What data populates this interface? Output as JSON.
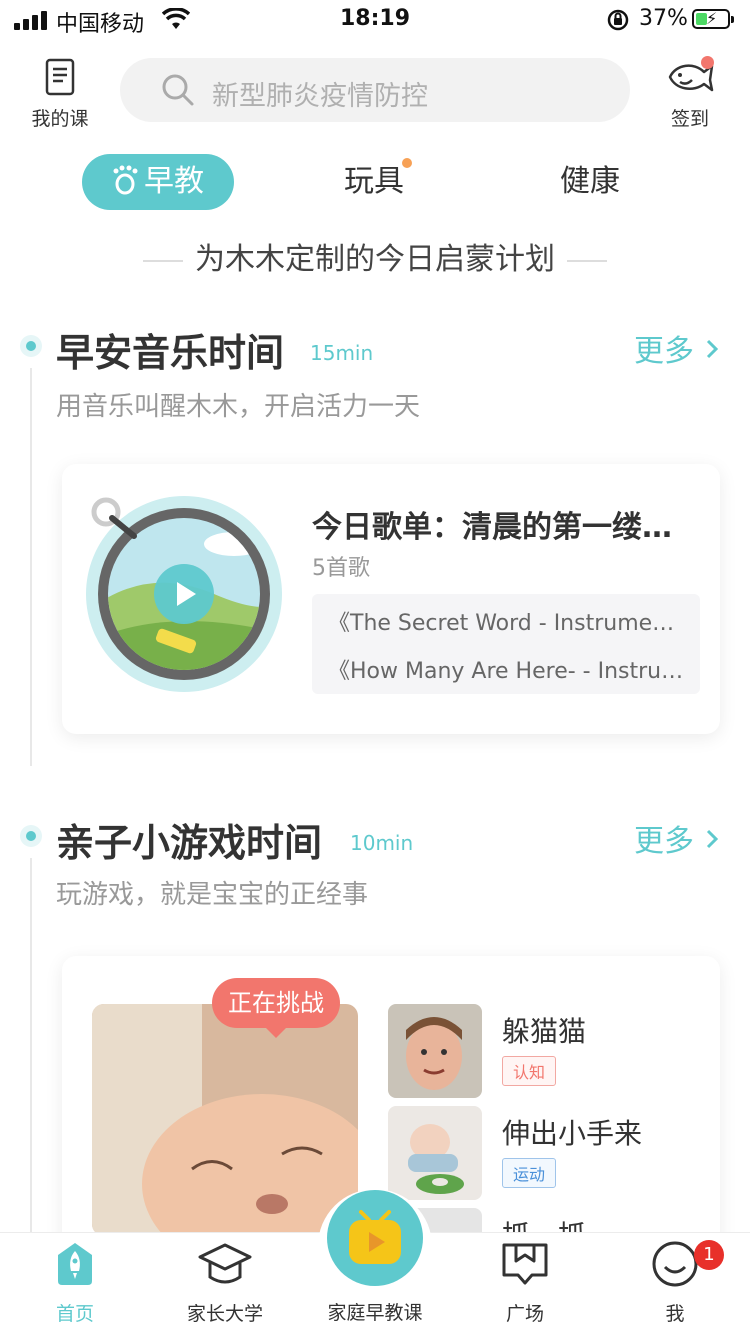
{
  "status_bar": {
    "carrier": "中国移动",
    "time": "18:19",
    "battery_percent": "37%",
    "battery_level": 0.37
  },
  "header": {
    "my_course_label": "我的课",
    "search_placeholder": "新型肺炎疫情防控",
    "signin_label": "签到"
  },
  "tabs": [
    {
      "label": "早教",
      "active": true
    },
    {
      "label": "玩具",
      "has_dot": true
    },
    {
      "label": "健康"
    }
  ],
  "plan_title": "为木木定制的今日启蒙计划",
  "sections": {
    "music": {
      "title": "早安音乐时间",
      "duration": "15min",
      "more": "更多",
      "subtitle": "用音乐叫醒木木，开启活力一天",
      "card": {
        "title": "今日歌单：清晨的第一缕阳光",
        "count": "5首歌",
        "songs": [
          "《The Secret Word - Instrumental》",
          "《How Many Are Here- - Instrumental》"
        ]
      }
    },
    "games": {
      "title": "亲子小游戏时间",
      "duration": "10min",
      "more": "更多",
      "subtitle": "玩游戏，就是宝宝的正经事",
      "challenge_label": "正在挑战",
      "items": [
        {
          "name": "躲猫猫",
          "tag": "认知"
        },
        {
          "name": "伸出小手来",
          "tag": "运动"
        },
        {
          "name": "抓一抓"
        }
      ]
    }
  },
  "bottom_nav": {
    "items": [
      {
        "label": "首页",
        "active": true
      },
      {
        "label": "家长大学"
      },
      {
        "label": "家庭早教课"
      },
      {
        "label": "广场"
      },
      {
        "label": "我"
      }
    ],
    "me_badge": "1"
  },
  "colors": {
    "accent": "#5ec9cd",
    "badge_red": "#e8302a",
    "challenge_red": "#f2766d",
    "tab_dot": "#f7a156"
  },
  "icons": [
    "signal-icon",
    "wifi-icon",
    "rotation-lock-icon",
    "battery-icon",
    "book-icon",
    "search-icon",
    "fish-icon",
    "footprint-icon",
    "chevron-right-icon",
    "play-icon",
    "rocket-icon",
    "graduation-cap-icon",
    "tv-icon",
    "square-icon",
    "smile-icon"
  ]
}
